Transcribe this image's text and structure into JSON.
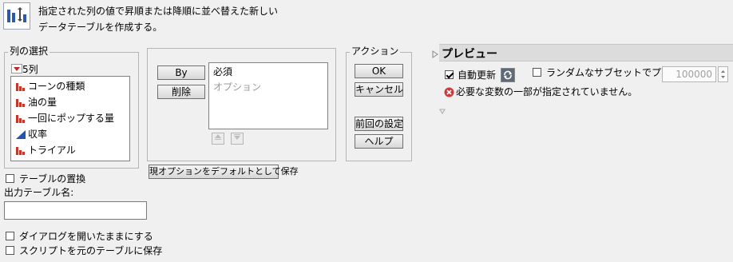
{
  "description": {
    "line1": "指定された列の値で昇順または降順に並べ替えた新しい",
    "line2": "データテーブルを作成する。"
  },
  "column_selection": {
    "title": "列の選択",
    "count_label": "5列",
    "columns": [
      {
        "name": "コーンの種類",
        "icon": "nominal-bar-icon"
      },
      {
        "name": "油の量",
        "icon": "nominal-bar-icon"
      },
      {
        "name": "一回にポップする量",
        "icon": "nominal-bar-icon"
      },
      {
        "name": "収率",
        "icon": "continuous-triangle-icon"
      },
      {
        "name": "トライアル",
        "icon": "nominal-bar-icon"
      }
    ]
  },
  "roles": {
    "by_button": "By",
    "remove_button": "削除",
    "required_label": "必須",
    "optional_label": "オプション"
  },
  "save_defaults_button": "現オプションをデフォルトとして保存",
  "actions": {
    "title": "アクション",
    "ok": "OK",
    "cancel": "キャンセル",
    "recall": "前回の設定",
    "help": "ヘルプ"
  },
  "preview": {
    "title": "プレビュー",
    "auto_update_label": "自動更新",
    "auto_update_checked": true,
    "random_subset_label": "ランダムなサブセットでプレビュー",
    "random_subset_value": "100000",
    "error_message": "必要な変数の一部が指定されていません。"
  },
  "options": {
    "replace_table_label": "テーブルの置換",
    "output_table_label": "出力テーブル名:",
    "output_table_value": "",
    "keep_dialog_open_label": "ダイアログを開いたままにする",
    "save_script_label": "スクリプトを元のテーブルに保存"
  },
  "colors": {
    "nominal_icon": "#c0392b",
    "continuous_icon": "#2255aa",
    "error_icon": "#d03a3a"
  }
}
